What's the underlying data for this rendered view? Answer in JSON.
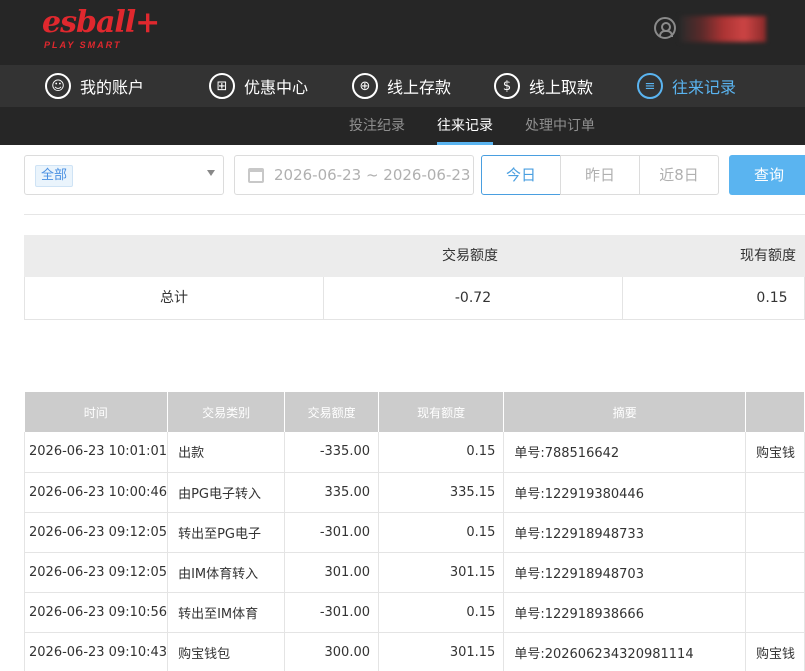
{
  "brand": {
    "logo_text": "esball+",
    "tagline": "PLAY SMART"
  },
  "nav": [
    {
      "label": "我的账户",
      "icon": "user-icon",
      "glyph": "☺"
    },
    {
      "label": "优惠中心",
      "icon": "gift-icon",
      "glyph": "⊞"
    },
    {
      "label": "线上存款",
      "icon": "deposit-icon",
      "glyph": "⊕"
    },
    {
      "label": "线上取款",
      "icon": "withdraw-icon",
      "glyph": "$"
    },
    {
      "label": "往来记录",
      "icon": "records-icon",
      "glyph": "≡",
      "active": true
    }
  ],
  "subnav": [
    {
      "label": "投注纪录"
    },
    {
      "label": "往来记录",
      "active": true
    },
    {
      "label": "处理中订单"
    }
  ],
  "filters": {
    "category": "全部",
    "date_range": "2026-06-23 ~ 2026-06-23",
    "quick_ranges": [
      "今日",
      "昨日",
      "近8日"
    ],
    "selected_range": "今日",
    "query_label": "查询"
  },
  "summary": {
    "headers": [
      "交易额度",
      "现有额度"
    ],
    "row_label": "总计",
    "amount": "-0.72",
    "balance": "0.15"
  },
  "table": {
    "headers": [
      "时间",
      "交易类别",
      "交易额度",
      "现有额度",
      "摘要",
      ""
    ],
    "rows": [
      [
        "2026-06-23 10:01:01",
        "出款",
        "-335.00",
        "0.15",
        "单号:788516642",
        "购宝钱"
      ],
      [
        "2026-06-23 10:00:46",
        "由PG电子转入",
        "335.00",
        "335.15",
        "单号:122919380446",
        ""
      ],
      [
        "2026-06-23 09:12:05",
        "转出至PG电子",
        "-301.00",
        "0.15",
        "单号:122918948733",
        ""
      ],
      [
        "2026-06-23 09:12:05",
        "由IM体育转入",
        "301.00",
        "301.15",
        "单号:122918948703",
        ""
      ],
      [
        "2026-06-23 09:10:56",
        "转出至IM体育",
        "-301.00",
        "0.15",
        "单号:122918938666",
        ""
      ],
      [
        "2026-06-23 09:10:43",
        "购宝钱包",
        "300.00",
        "301.15",
        "单号:202606234320981114",
        "购宝钱"
      ]
    ]
  },
  "colors": {
    "accent": "#5ab4f0",
    "brand": "#e0282e",
    "header_bg": "#262626",
    "nav_bg": "#333333"
  }
}
